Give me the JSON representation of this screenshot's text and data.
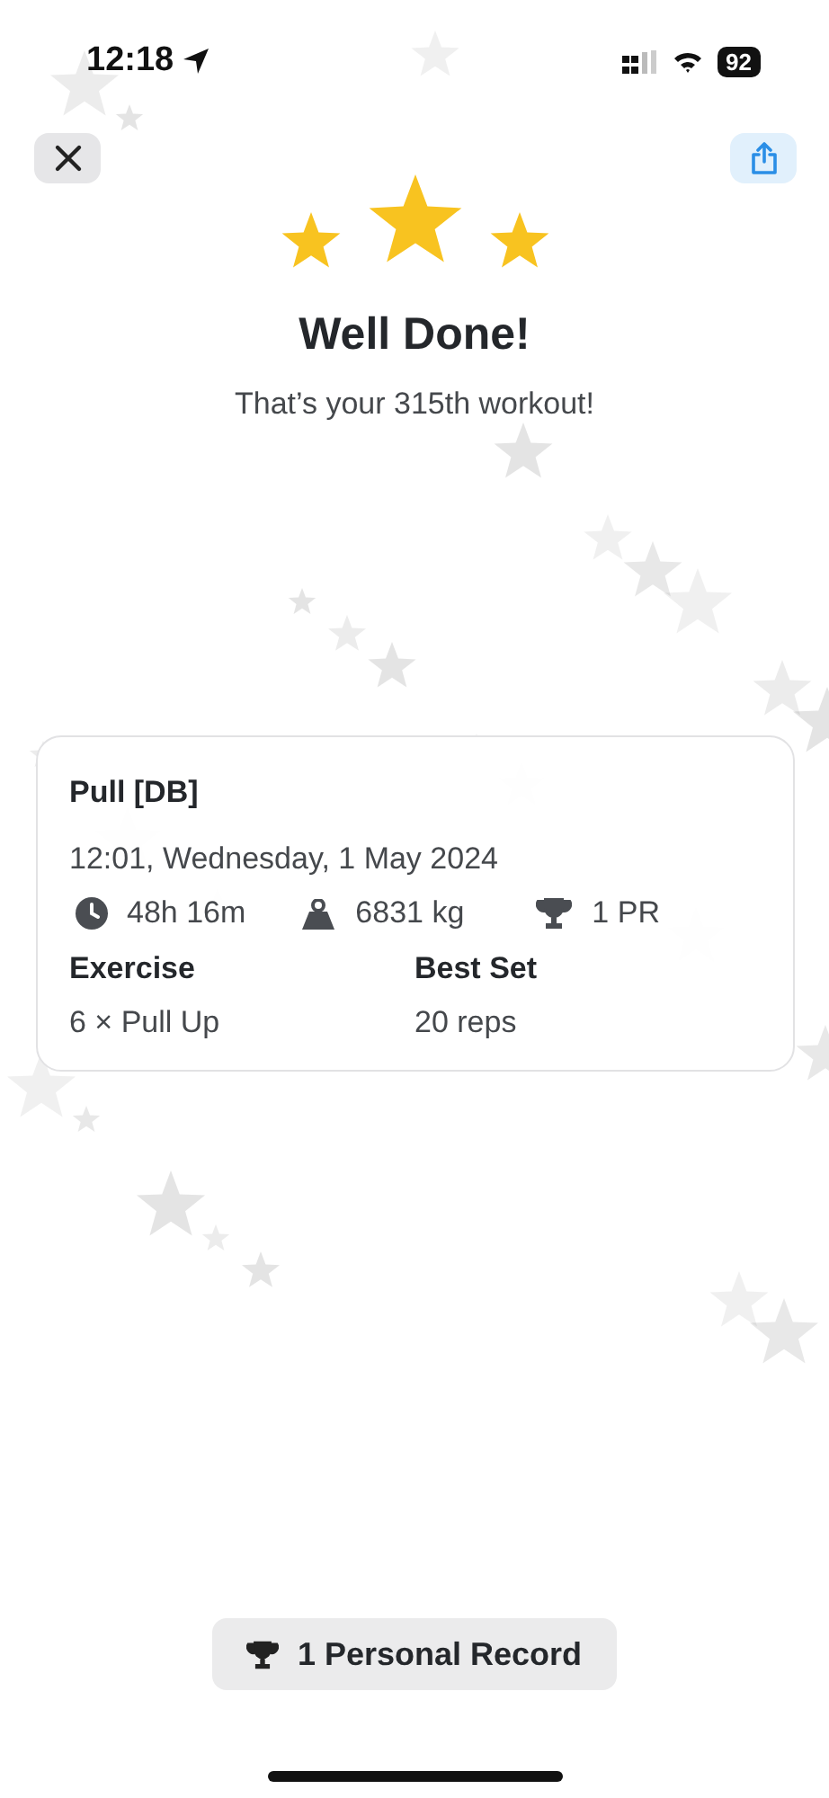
{
  "status_bar": {
    "time": "12:18",
    "battery": "92"
  },
  "celebration": {
    "title": "Well Done!",
    "subtitle": "That’s your 315th workout!"
  },
  "workout": {
    "name": "Pull [DB]",
    "date": "12:01, Wednesday, 1 May 2024",
    "stats": [
      {
        "kind": "duration",
        "value": "48h 16m"
      },
      {
        "kind": "volume",
        "value": "6831 kg"
      },
      {
        "kind": "records",
        "value": "1 PR"
      }
    ],
    "columns": [
      {
        "heading": "Exercise",
        "value": "6 × Pull Up"
      },
      {
        "heading": "Best Set",
        "value": "20 reps"
      }
    ]
  },
  "records_button": {
    "label": "1 Personal Record"
  }
}
